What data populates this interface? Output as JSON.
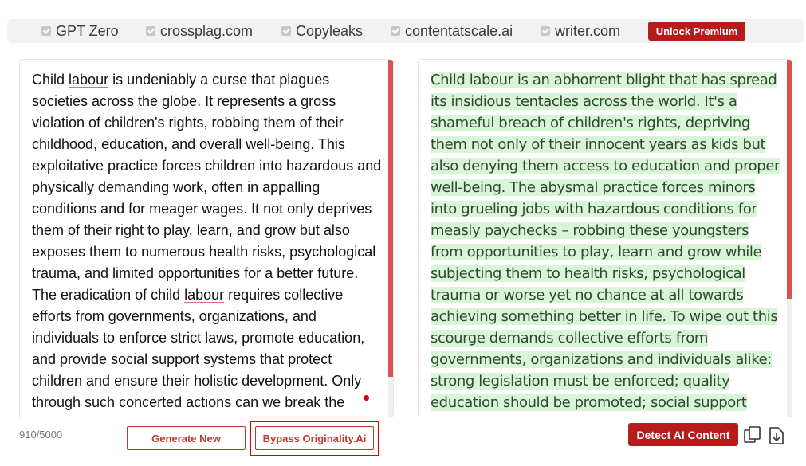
{
  "checkers": [
    {
      "label": "GPT Zero"
    },
    {
      "label": "crossplag.com"
    },
    {
      "label": "Copyleaks"
    },
    {
      "label": "contentatscale.ai"
    },
    {
      "label": "writer.com"
    }
  ],
  "unlock_label": "Unlock Premium",
  "input": {
    "segments": [
      "Child ",
      "labour",
      " is undeniably a curse that plagues societies across the globe. It represents a gross violation of children's rights, robbing them of their childhood, education, and overall well-being. This exploitative practice forces children into hazardous and physically demanding work, often in appalling conditions and for meager wages. It not only deprives them of their right to play, learn, and grow but also exposes them to numerous health risks, psychological trauma, and limited opportunities for a better future. The eradication of child ",
      "labour",
      " requires collective efforts from governments, organizations, and individuals to enforce strict laws, promote education, and provide social support systems that protect children and ensure their holistic development. Only through such concerted actions can we break the"
    ]
  },
  "output": {
    "text": "Child labour is an abhorrent blight that has spread its insidious tentacles across the world. It's a shameful breach of children's rights, depriving them not only of their innocent years as kids but also denying them access to education and proper well-being. The abysmal practice forces minors into grueling jobs with hazardous conditions for measly paychecks – robbing these youngsters from opportunities to play, learn and grow while subjecting them to health risks, psychological trauma or worse yet no chance at all towards achieving something better in life. To wipe out this scourge demands collective efforts from governments, organizations and individuals alike: strong legislation must be enforced; quality education should be promoted; social support"
  },
  "char_count": "910/5000",
  "buttons": {
    "generate": "Generate New",
    "bypass": "Bypass Originality.Ai",
    "detect": "Detect AI Content"
  },
  "colors": {
    "accent": "#b71c1c",
    "highlight": "#d8f5d8",
    "scrollbar": "#d9534f"
  },
  "icons": [
    "checkbox-icon",
    "copy-icon",
    "download-icon"
  ]
}
